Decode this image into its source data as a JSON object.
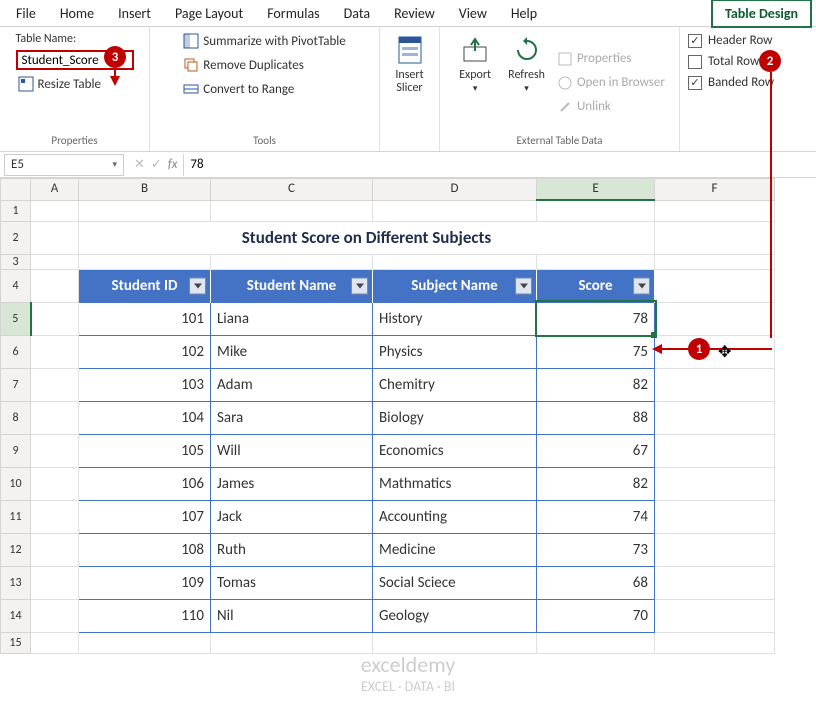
{
  "tabs": {
    "file": "File",
    "home": "Home",
    "insert": "Insert",
    "page_layout": "Page Layout",
    "formulas": "Formulas",
    "data": "Data",
    "review": "Review",
    "view": "View",
    "help": "Help",
    "table_design": "Table Design"
  },
  "ribbon": {
    "table_name_label": "Table Name:",
    "table_name_value": "Student_Score",
    "resize_table": "Resize Table",
    "group_properties": "Properties",
    "summarize_pivot": "Summarize with PivotTable",
    "remove_duplicates": "Remove Duplicates",
    "convert_range": "Convert to Range",
    "group_tools": "Tools",
    "insert_slicer": "Insert\nSlicer",
    "export": "Export",
    "refresh": "Refresh",
    "properties": "Properties",
    "open_browser": "Open in Browser",
    "unlink": "Unlink",
    "group_external": "External Table Data",
    "header_row": "Header Row",
    "total_row": "Total Row",
    "banded_rows": "Banded Row"
  },
  "namebox": "E5",
  "formula_value": "78",
  "columns": {
    "a": "A",
    "b": "B",
    "c": "C",
    "d": "D",
    "e": "E",
    "f": "F"
  },
  "col_widths": {
    "a": 48,
    "b": 132,
    "c": 162,
    "d": 164,
    "e": 118,
    "f": 120
  },
  "title": "Student Score on Different Subjects",
  "headers": {
    "id": "Student ID",
    "name": "Student Name",
    "subject": "Subject Name",
    "score": "Score"
  },
  "rows": [
    {
      "n": "1"
    },
    {
      "n": "2"
    },
    {
      "n": "3"
    },
    {
      "n": "4"
    },
    {
      "n": "5",
      "id": "101",
      "name": "Liana",
      "subject": "History",
      "score": "78"
    },
    {
      "n": "6",
      "id": "102",
      "name": "Mike",
      "subject": "Physics",
      "score": "75"
    },
    {
      "n": "7",
      "id": "103",
      "name": "Adam",
      "subject": "Chemitry",
      "score": "82"
    },
    {
      "n": "8",
      "id": "104",
      "name": "Sara",
      "subject": "Biology",
      "score": "88"
    },
    {
      "n": "9",
      "id": "105",
      "name": "Will",
      "subject": "Economics",
      "score": "67"
    },
    {
      "n": "10",
      "id": "106",
      "name": "James",
      "subject": "Mathmatics",
      "score": "82"
    },
    {
      "n": "11",
      "id": "107",
      "name": "Jack",
      "subject": "Accounting",
      "score": "74"
    },
    {
      "n": "12",
      "id": "108",
      "name": "Ruth",
      "subject": "Medicine",
      "score": "73"
    },
    {
      "n": "13",
      "id": "109",
      "name": "Tomas",
      "subject": "Social Sciece",
      "score": "68"
    },
    {
      "n": "14",
      "id": "110",
      "name": "Nil",
      "subject": "Geology",
      "score": "70"
    },
    {
      "n": "15"
    }
  ],
  "annotations": {
    "one": "1",
    "two": "2",
    "three": "3"
  },
  "watermark": {
    "brand": "exceldemy",
    "tagline": "EXCEL · DATA · BI"
  }
}
